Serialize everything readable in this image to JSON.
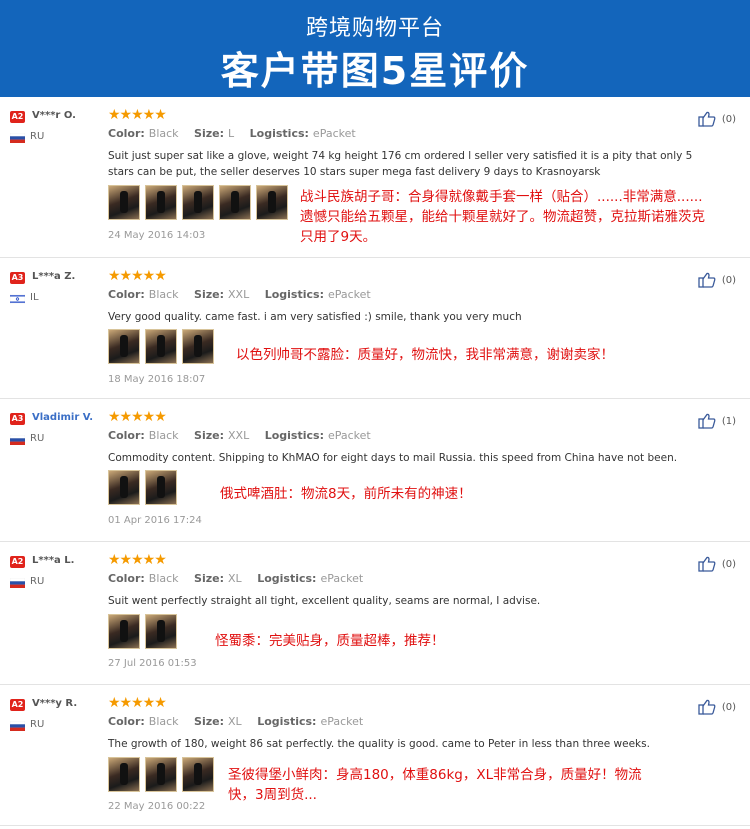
{
  "header": {
    "subtitle": "跨境购物平台",
    "title": "客户带图5星评价"
  },
  "labels": {
    "color": "Color:",
    "size": "Size:",
    "logistics": "Logistics:"
  },
  "reviews": [
    {
      "level": "A2",
      "user": "V***r O.",
      "country": "RU",
      "stars": "★★★★★",
      "color": "Black",
      "size": "L",
      "logistics": "ePacket",
      "text": "Suit just super sat like a glove, weight 74 kg height 176 cm ordered l seller very satisfied it is a pity that only 5 stars can be put, the seller deserves 10 stars super mega fast delivery 9 days to Krasnoyarsk",
      "cn": "战斗民族胡子哥：合身得就像戴手套一样（贴合）......非常满意......遗憾只能给五颗星，能给十颗星就好了。物流超赞，克拉斯诺雅茨克只用了9天。",
      "date": "24 May 2016 14:03",
      "likes": "(0)"
    },
    {
      "level": "A3",
      "user": "L***a Z.",
      "country": "IL",
      "stars": "★★★★★",
      "color": "Black",
      "size": "XXL",
      "logistics": "ePacket",
      "text": "Very good quality. came fast. i am very satisfied :) smile, thank you very much",
      "cn": "以色列帅哥不露脸：质量好，物流快，我非常满意，谢谢卖家！",
      "date": "18 May 2016 18:07",
      "likes": "(0)"
    },
    {
      "level": "A3",
      "user": "Vladimir V.",
      "country": "RU",
      "stars": "★★★★★",
      "color": "Black",
      "size": "XXL",
      "logistics": "ePacket",
      "text": "Commodity content. Shipping to KhMAO for eight days to mail Russia. this speed from China have not been.",
      "cn": "俄式啤酒肚：物流8天，前所未有的神速！",
      "date": "01 Apr 2016 17:24",
      "likes": "(1)"
    },
    {
      "level": "A2",
      "user": "L***a L.",
      "country": "RU",
      "stars": "★★★★★",
      "color": "Black",
      "size": "XL",
      "logistics": "ePacket",
      "text": "Suit went perfectly straight all tight, excellent quality, seams are normal, I advise.",
      "cn": "怪蜀黍：完美贴身，质量超棒，推荐！",
      "date": "27 Jul 2016 01:53",
      "likes": "(0)"
    },
    {
      "level": "A2",
      "user": "V***y R.",
      "country": "RU",
      "stars": "★★★★★",
      "color": "Black",
      "size": "XL",
      "logistics": "ePacket",
      "text": "The growth of 180, weight 86 sat perfectly. the quality is good. came to Peter in less than three weeks.",
      "cn": "圣彼得堡小鲜肉：身高180，体重86kg，XL非常合身，质量好！物流快，3周到货...",
      "date": "22 May 2016 00:22",
      "likes": "(0)"
    }
  ],
  "colors": {
    "header_bg": "#1365bb",
    "accent_red": "#e01010",
    "star": "#f59a00"
  }
}
